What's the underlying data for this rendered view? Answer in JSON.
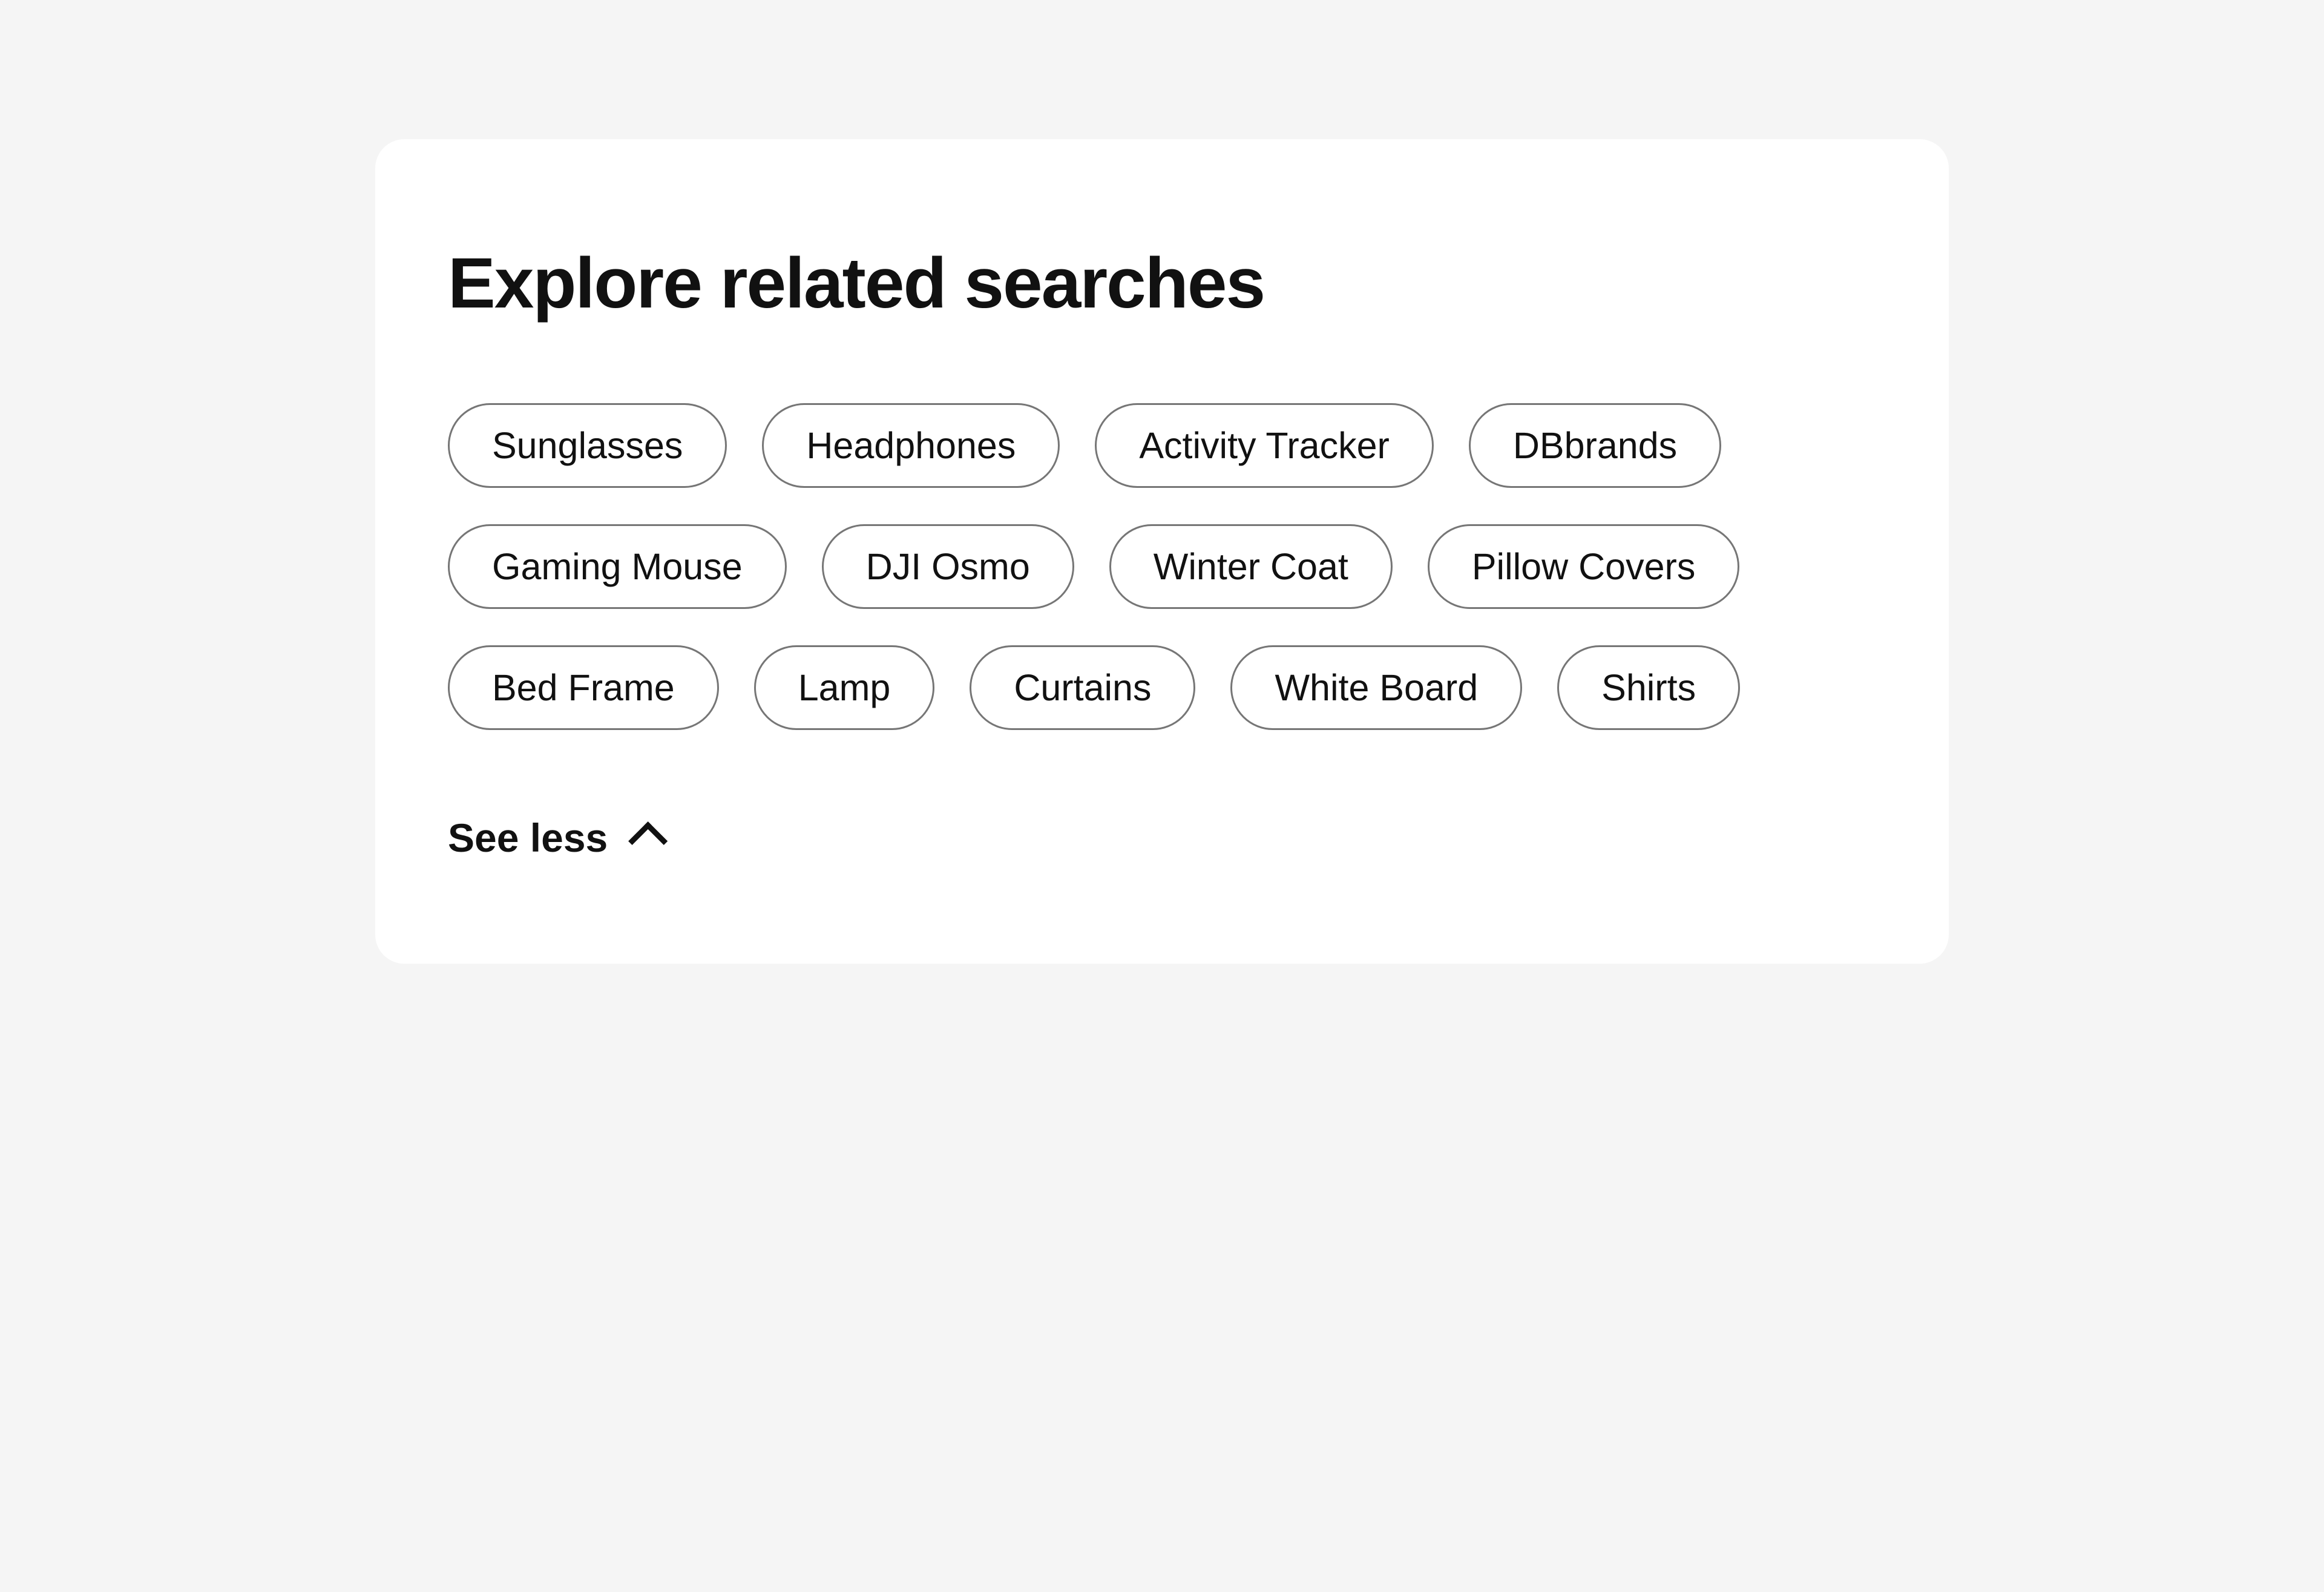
{
  "heading": "Explore related searches",
  "chips": [
    "Sunglasses",
    "Headphones",
    "Activity Tracker",
    "DBbrands",
    "Gaming Mouse",
    "DJI Osmo",
    "Winter Coat",
    "Pillow Covers",
    "Bed Frame",
    "Lamp",
    "Curtains",
    "White Board",
    "Shirts"
  ],
  "toggle_label": "See less"
}
